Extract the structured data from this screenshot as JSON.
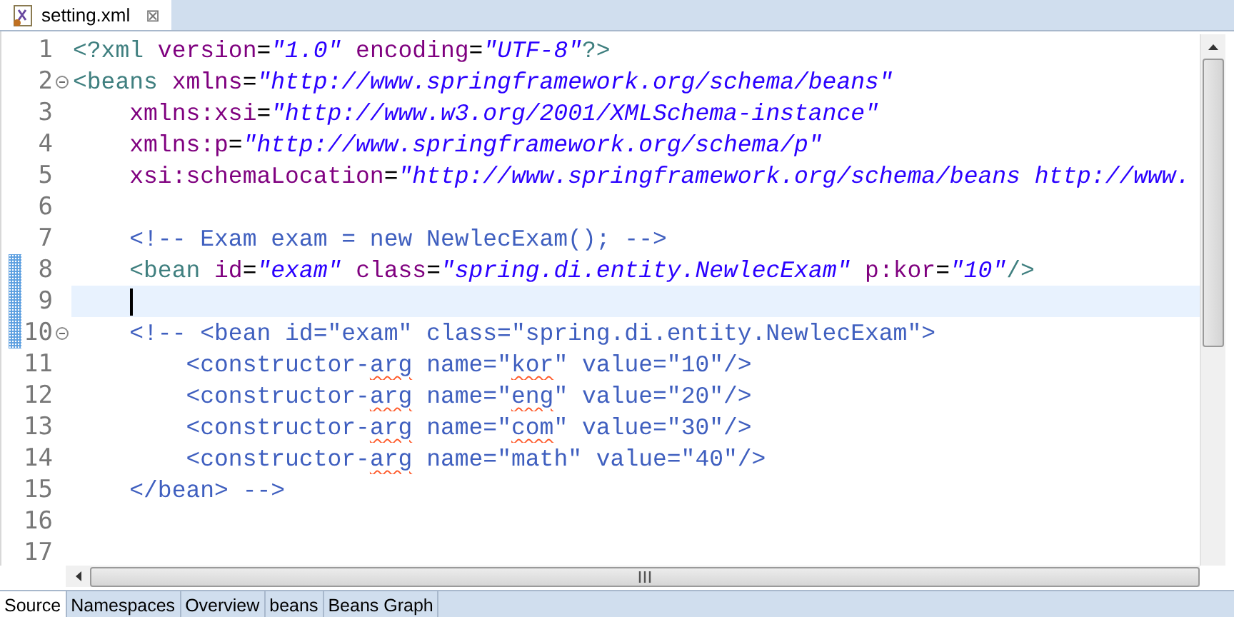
{
  "editor_tab": {
    "title": "setting.xml",
    "selected": true,
    "close": "⊠"
  },
  "lines": [
    {
      "number": "1",
      "changed": false,
      "current": false,
      "foldable": false,
      "tokens": [
        {
          "text": "<?xml ",
          "kind": "tag"
        },
        {
          "text": "version",
          "kind": "attr"
        },
        {
          "text": "=",
          "kind": "plain"
        },
        {
          "text": "\"1.0\"",
          "kind": "string"
        },
        {
          "text": " encoding",
          "kind": "attr"
        },
        {
          "text": "=",
          "kind": "plain"
        },
        {
          "text": "\"UTF-8\"",
          "kind": "string"
        },
        {
          "text": "?>",
          "kind": "tag"
        }
      ]
    },
    {
      "number": "2",
      "changed": false,
      "current": false,
      "foldable": true,
      "tokens": [
        {
          "text": "<beans ",
          "kind": "tag"
        },
        {
          "text": "xmlns",
          "kind": "attr"
        },
        {
          "text": "=",
          "kind": "plain"
        },
        {
          "text": "\"http://www.springframework.org/schema/beans\"",
          "kind": "string"
        }
      ]
    },
    {
      "number": "3",
      "changed": false,
      "current": false,
      "foldable": false,
      "tokens": [
        {
          "text": "    xmlns:xsi",
          "kind": "attr"
        },
        {
          "text": "=",
          "kind": "plain"
        },
        {
          "text": "\"http://www.w3.org/2001/XMLSchema-instance\"",
          "kind": "string"
        }
      ]
    },
    {
      "number": "4",
      "changed": false,
      "current": false,
      "foldable": false,
      "tokens": [
        {
          "text": "    xmlns:p",
          "kind": "attr"
        },
        {
          "text": "=",
          "kind": "plain"
        },
        {
          "text": "\"http://www.springframework.org/schema/p\"",
          "kind": "string"
        }
      ]
    },
    {
      "number": "5",
      "changed": false,
      "current": false,
      "foldable": false,
      "tokens": [
        {
          "text": "    xsi:schemaLocation",
          "kind": "attr"
        },
        {
          "text": "=",
          "kind": "plain"
        },
        {
          "text": "\"http://www.springframework.org/schema/beans http://www.",
          "kind": "string"
        }
      ]
    },
    {
      "number": "6",
      "changed": false,
      "current": false,
      "foldable": false
    },
    {
      "number": "7",
      "changed": false,
      "current": false,
      "foldable": false,
      "tokens": [
        {
          "text": "    <!-- Exam exam = new NewlecExam(); -->",
          "kind": "comment"
        }
      ]
    },
    {
      "number": "8",
      "changed": true,
      "current": false,
      "foldable": false,
      "tokens": [
        {
          "text": "    <bean ",
          "kind": "tag"
        },
        {
          "text": "id",
          "kind": "attr"
        },
        {
          "text": "=",
          "kind": "plain"
        },
        {
          "text": "\"exam\"",
          "kind": "string"
        },
        {
          "text": " class",
          "kind": "attr"
        },
        {
          "text": "=",
          "kind": "plain"
        },
        {
          "text": "\"spring.di.entity.NewlecExam\"",
          "kind": "string"
        },
        {
          "text": " p:kor",
          "kind": "attr"
        },
        {
          "text": "=",
          "kind": "plain"
        },
        {
          "text": "\"10\"",
          "kind": "string"
        },
        {
          "text": "/>",
          "kind": "tag"
        }
      ]
    },
    {
      "number": "9",
      "changed": true,
      "current": true,
      "foldable": false
    },
    {
      "number": "10",
      "changed": true,
      "current": false,
      "foldable": true,
      "tokens": [
        {
          "text": "    <!-- <bean id=\"exam\" class=\"spring.di.entity.NewlecExam\">",
          "kind": "comment"
        }
      ]
    },
    {
      "number": "11",
      "changed": false,
      "current": false,
      "foldable": false,
      "tokens": [
        {
          "text": "        <constructor-",
          "kind": "comment"
        },
        {
          "text": "arg",
          "kind": "misspelled"
        },
        {
          "text": " name=\"",
          "kind": "comment"
        },
        {
          "text": "kor",
          "kind": "misspelled"
        },
        {
          "text": "\" value=\"10\"/>",
          "kind": "comment"
        }
      ]
    },
    {
      "number": "12",
      "changed": false,
      "current": false,
      "foldable": false,
      "tokens": [
        {
          "text": "        <constructor-",
          "kind": "comment"
        },
        {
          "text": "arg",
          "kind": "misspelled"
        },
        {
          "text": " name=\"",
          "kind": "comment"
        },
        {
          "text": "eng",
          "kind": "misspelled"
        },
        {
          "text": "\" value=\"20\"/>",
          "kind": "comment"
        }
      ]
    },
    {
      "number": "13",
      "changed": false,
      "current": false,
      "foldable": false,
      "tokens": [
        {
          "text": "        <constructor-",
          "kind": "comment"
        },
        {
          "text": "arg",
          "kind": "misspelled"
        },
        {
          "text": " name=\"",
          "kind": "comment"
        },
        {
          "text": "com",
          "kind": "misspelled"
        },
        {
          "text": "\" value=\"30\"/>",
          "kind": "comment"
        }
      ]
    },
    {
      "number": "14",
      "changed": false,
      "current": false,
      "foldable": false,
      "tokens": [
        {
          "text": "        <constructor-",
          "kind": "comment"
        },
        {
          "text": "arg",
          "kind": "misspelled"
        },
        {
          "text": " name=\"math\" value=\"40\"/>",
          "kind": "comment"
        }
      ]
    },
    {
      "number": "15",
      "changed": false,
      "current": false,
      "foldable": false,
      "tokens": [
        {
          "text": "    </bean> -->",
          "kind": "comment"
        }
      ]
    },
    {
      "number": "16",
      "changed": false,
      "current": false,
      "foldable": false
    },
    {
      "number": "17",
      "changed": false,
      "current": false,
      "foldable": false
    }
  ],
  "page_tabs": [
    {
      "label": "Source",
      "selected": true
    },
    {
      "label": "Namespaces",
      "selected": false
    },
    {
      "label": "Overview",
      "selected": false
    },
    {
      "label": "beans",
      "selected": false
    },
    {
      "label": "Beans Graph",
      "selected": false
    }
  ]
}
